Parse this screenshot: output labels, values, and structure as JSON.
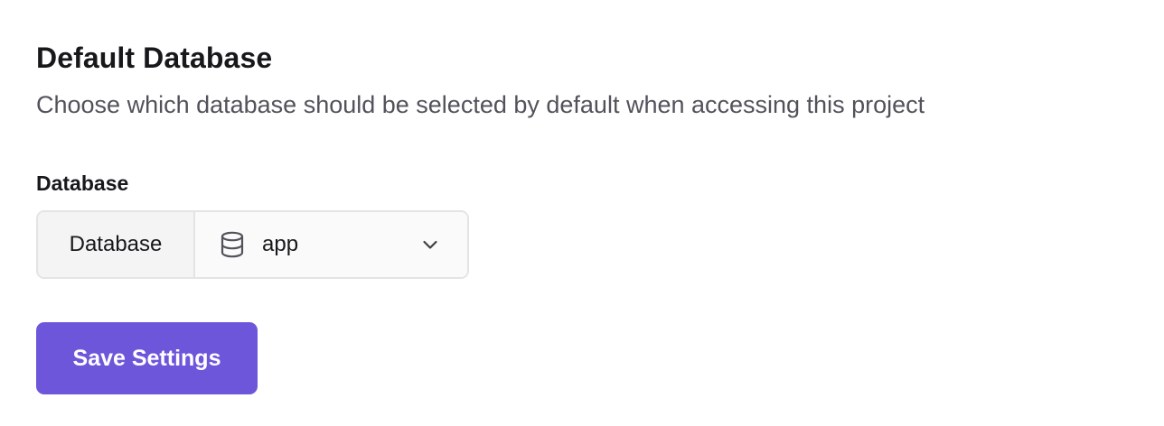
{
  "section": {
    "title": "Default Database",
    "description": "Choose which database should be selected by default when accessing this project"
  },
  "field": {
    "label": "Database",
    "addon_label": "Database",
    "selected_value": "app",
    "value_icon": "database-icon",
    "dropdown_icon": "chevron-down-icon"
  },
  "actions": {
    "save_label": "Save Settings"
  },
  "colors": {
    "primary": "#6e56db",
    "text": "#18181b",
    "muted_text": "#52525b",
    "border": "#e4e4e7"
  }
}
